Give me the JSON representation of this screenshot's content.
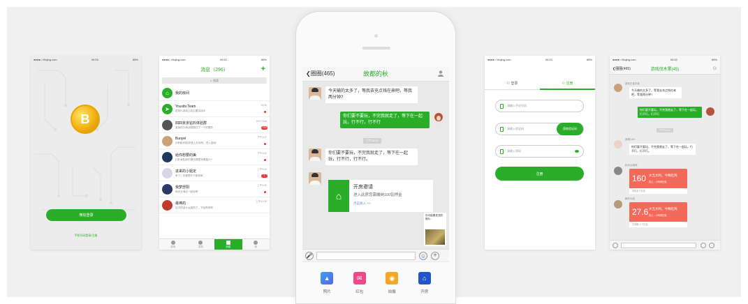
{
  "status_bar": {
    "carrier": "●●●●○ Mojing.com",
    "time": "00:53",
    "time_alt": "00:52",
    "battery": "88%"
  },
  "login": {
    "wechat_button": "微信登录",
    "alt_login": "手机号码登录/注册"
  },
  "messages": {
    "title": "消息（296）",
    "search_placeholder": "搜索",
    "rows": [
      {
        "name": "我的房间",
        "preview": "",
        "time": "",
        "badge": ""
      },
      {
        "name": "Youxibi Team",
        "preview": "发现小游戏上线主题活动中",
        "time": "13:30",
        "badge": ""
      },
      {
        "name": "四四京京钻石体验群",
        "preview": "某某的小粉丝刚刚打了一个好看的",
        "time": "2017/11/6",
        "badge": "139"
      },
      {
        "name": "Bunyel",
        "preview": "[2条新消息]你想上去玩吧，进入游戏!",
        "time": "下午4:27",
        "badge": ""
      },
      {
        "name": "给你想要的美",
        "preview": "[1条消息]你们要去哪里玩得高兴?",
        "time": "下午4:02",
        "badge": ""
      },
      {
        "name": "进来的小姐定",
        "preview": "来了！在哪里开个新房间",
        "time": "上午9:00",
        "badge": "2"
      },
      {
        "name": "我梦舒阳",
        "preview": "明天去海边一起玩吧",
        "time": "上午9:00",
        "badge": ""
      },
      {
        "name": "最棒的",
        "preview": "这次的战斗太激烈了，下回再来吧",
        "time": "上午01:30",
        "badge": ""
      }
    ],
    "tabs": [
      "游戏",
      "发现",
      "消息",
      "我"
    ]
  },
  "chat": {
    "back": "圈圈(465)",
    "title": "故都的秋",
    "msg1": "今天输的太多了，等我去充点钱在来吧，等我两分钟?",
    "msg2": "你们要不要玩，不完我就走了，等下在一起玩，行不行，行不行",
    "timestamp": "下午15:44",
    "msg3": "你们要不要玩，不完我就走了，等下在一起玩，行不行，行不行。",
    "room_title": "开房邀请",
    "room_desc": "进入此房您需缴纳100钻押金",
    "room_action": "点击加入 >>",
    "share_text": "你可能要发送的照片：",
    "tools": [
      "照片",
      "红包",
      "拍摄",
      "开房"
    ]
  },
  "register": {
    "tab_login": "登录",
    "tab_register": "注册",
    "phone_placeholder": "请输入手机号码",
    "code_placeholder": "请输入验证码",
    "get_code": "获取验证码",
    "password_placeholder": "请输入密码",
    "submit": "注册"
  },
  "group": {
    "back": "圈圈(465)",
    "title": "游戏伐木累(45)",
    "name1": "游戏王者丰收",
    "msg1": "今天输的太多了，等我去充点钱在来吧，等我两分钟?",
    "msg2": "你们要不要玩，不完我就走了，等下在一起玩，行不行，行不行",
    "timestamp": "下午15:44",
    "name2": "我是LAN",
    "msg3": "你们要不要玩，不完我就走了，等下在一起玩，行不行，行不行。",
    "name3": "杭州大咖啡",
    "red1_num": "160",
    "red1_t1": "大吉大利，今晚吃鸡",
    "red1_t2": "向上：小鸡哥红包",
    "red1_ft": "你抢走了红包",
    "name4": "新的大叔",
    "red2_num": "27.6",
    "red2_t1": "大吉大利，今晚吃鸡",
    "red2_t2": "向上：小鸡哥红包",
    "red2_ft": "已领取 1 个红包"
  }
}
